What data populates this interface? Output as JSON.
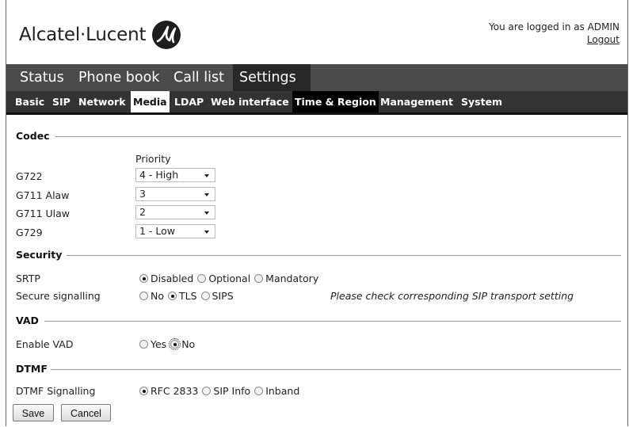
{
  "header": {
    "logo_text": "Alcatel·Lucent",
    "logged_in_text": "You are logged in as ADMIN",
    "logout_label": "Logout"
  },
  "main_nav": {
    "items": [
      "Status",
      "Phone book",
      "Call list",
      "Settings"
    ],
    "active": "Settings"
  },
  "sub_nav": {
    "items": [
      "Basic",
      "SIP",
      "Network",
      "Media",
      "LDAP",
      "Web interface",
      "Time & Region",
      "Management",
      "System"
    ],
    "active": "Media"
  },
  "codec": {
    "title": "Codec",
    "priority_header": "Priority",
    "rows": [
      {
        "label": "G722",
        "value": "4 - High"
      },
      {
        "label": "G711 Alaw",
        "value": "3"
      },
      {
        "label": "G711 Ulaw",
        "value": "2"
      },
      {
        "label": "G729",
        "value": "1 - Low"
      }
    ]
  },
  "security": {
    "title": "Security",
    "srtp": {
      "label": "SRTP",
      "options": [
        "Disabled",
        "Optional",
        "Mandatory"
      ],
      "selected": "Disabled"
    },
    "secure_signalling": {
      "label": "Secure signalling",
      "options": [
        "No",
        "TLS",
        "SIPS"
      ],
      "selected": "TLS",
      "note": "Please check corresponding SIP transport setting"
    }
  },
  "vad": {
    "title": "VAD",
    "enable": {
      "label": "Enable VAD",
      "options": [
        "Yes",
        "No"
      ],
      "selected": "No"
    }
  },
  "dtmf": {
    "title": "DTMF",
    "signalling": {
      "label": "DTMF Signalling",
      "options": [
        "RFC 2833",
        "SIP Info",
        "Inband"
      ],
      "selected": "RFC 2833"
    }
  },
  "buttons": {
    "save": "Save",
    "cancel": "Cancel"
  },
  "colors": {
    "nav_bg": "#4a4a4a",
    "subnav_bg": "#333333",
    "active_main_bg": "#282828"
  }
}
